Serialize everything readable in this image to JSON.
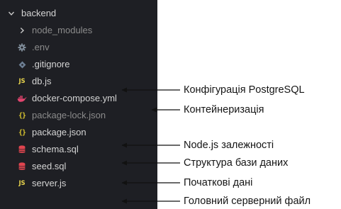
{
  "explorer": {
    "items": [
      {
        "label": "backend",
        "icon": "chevron-down-icon",
        "dim": false
      },
      {
        "label": "node_modules",
        "icon": "chevron-right-icon",
        "dim": true
      },
      {
        "label": ".env",
        "icon": "gear-icon",
        "dim": true
      },
      {
        "label": ".gitignore",
        "icon": "git-diamond-icon",
        "dim": false
      },
      {
        "label": "db.js",
        "icon": "js-icon",
        "icon_text": "JS",
        "dim": false
      },
      {
        "label": "docker-compose.yml",
        "icon": "docker-whale-icon",
        "dim": false
      },
      {
        "label": "package-lock.json",
        "icon": "json-braces-icon",
        "icon_text": "{}",
        "dim": true
      },
      {
        "label": "package.json",
        "icon": "json-braces-icon",
        "icon_text": "{}",
        "dim": false
      },
      {
        "label": "schema.sql",
        "icon": "database-icon",
        "dim": false
      },
      {
        "label": "seed.sql",
        "icon": "database-icon",
        "dim": false
      },
      {
        "label": "server.js",
        "icon": "js-icon",
        "icon_text": "JS",
        "dim": false
      }
    ]
  },
  "annotations": [
    {
      "text": "Конфігурація PostgreSQL"
    },
    {
      "text": "Контейнеризація"
    },
    {
      "text": "Node.js залежності"
    },
    {
      "text": "Структура бази даних"
    },
    {
      "text": "Початкові дані"
    },
    {
      "text": "Головний серверний файл"
    }
  ],
  "colors": {
    "panel_bg": "#1e1f24",
    "text": "#d4d4d4",
    "dim_text": "#8b8b8b",
    "js_yellow": "#e8d44d",
    "json_yellow": "#d7c32f",
    "docker_pink": "#e2456e",
    "sql_red": "#e0454f",
    "env_gray": "#7f8c99",
    "git_gray": "#6d7f94"
  }
}
